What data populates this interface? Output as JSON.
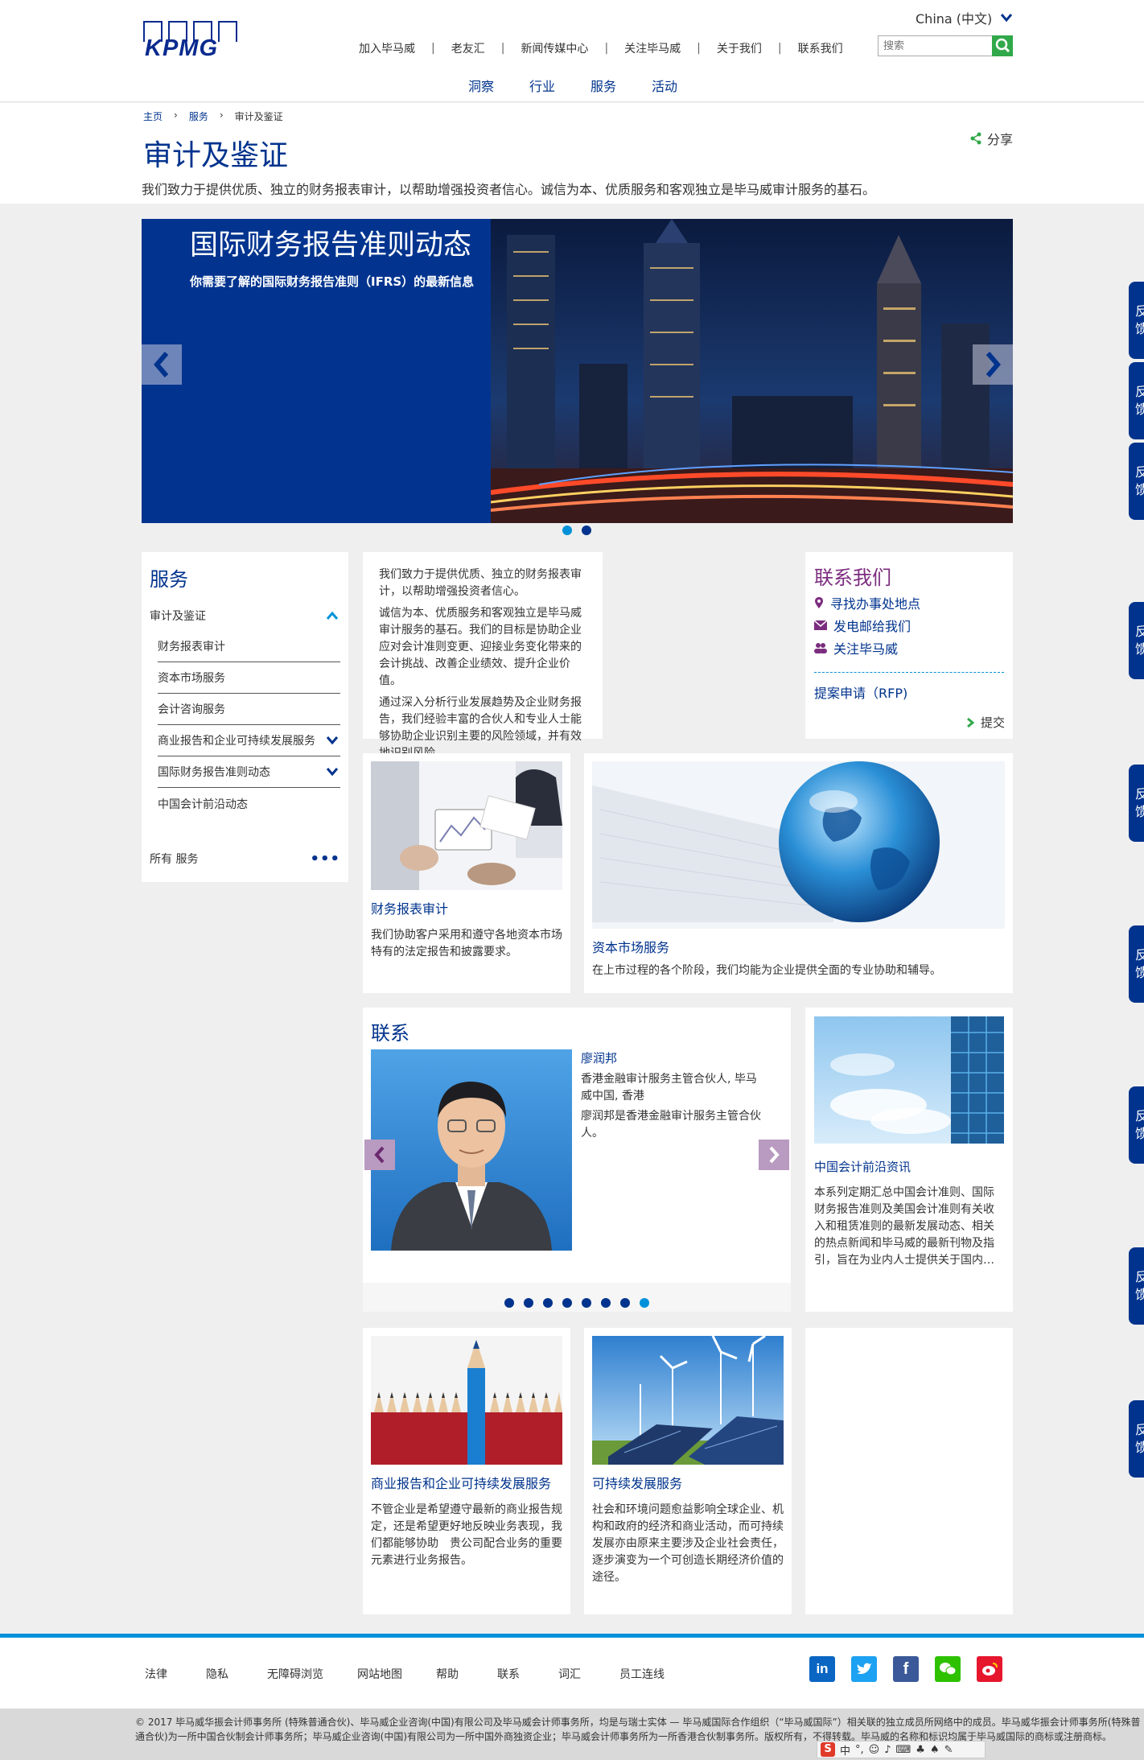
{
  "header": {
    "logo_text": "KPMG",
    "language": "China (中文)",
    "top_links": [
      "加入毕马威",
      "老友汇",
      "新闻传媒中心",
      "关注毕马威",
      "关于我们",
      "联系我们"
    ],
    "search_placeholder": "搜索",
    "main_nav": [
      "洞察",
      "行业",
      "服务",
      "活动"
    ]
  },
  "breadcrumb": [
    "主页",
    "服务",
    "审计及鉴证"
  ],
  "page_title": "审计及鉴证",
  "share_label": "分享",
  "intro": "我们致力于提供优质、独立的财务报表审计，以帮助增强投资者信心。诚信为本、优质服务和客观独立是毕马威审计服务的基石。",
  "hero": {
    "title": "国际财务报告准则动态",
    "subtitle": "你需要了解的国际财务报告准则（IFRS）的最新信息"
  },
  "sidebar": {
    "title": "服务",
    "current": "审计及鉴证",
    "items": [
      {
        "label": "财务报表审计",
        "expand": false
      },
      {
        "label": "资本市场服务",
        "expand": false
      },
      {
        "label": "会计咨询服务",
        "expand": false
      },
      {
        "label": "商业报告和企业可持续发展服务",
        "expand": true
      },
      {
        "label": "国际财务报告准则动态",
        "expand": true
      },
      {
        "label": "中国会计前沿动态",
        "expand": false
      }
    ],
    "all_services": "所有 服务"
  },
  "about": {
    "p1": "我们致力于提供优质、独立的财务报表审计，以帮助增强投资者信心。",
    "p2": "诚信为本、优质服务和客观独立是毕马威审计服务的基石。我们的目标是协助企业应对会计准则变更、迎接业务变化带来的会计挑战、改善企业绩效、提升企业价值。",
    "p3": "通过深入分析行业发展趋势及企业财务报告，我们经验丰富的合伙人和专业人士能够协助企业识别主要的风险领域，并有效地识别风险。"
  },
  "contact_us": {
    "title": "联系我们",
    "links": [
      "寻找办事处地点",
      "发电邮给我们",
      "关注毕马威"
    ],
    "rfp": "提案申请（RFP)",
    "submit": "提交"
  },
  "cards": {
    "audit": {
      "title": "财务报表审计",
      "text": "我们协助客户采用和遵守各地资本市场特有的法定报告和披露要求。"
    },
    "capital": {
      "title": "资本市场服务",
      "text": "在上市过程的各个阶段，我们均能为企业提供全面的专业协助和辅导。"
    },
    "china": {
      "title": "中国会计前沿资讯",
      "text": "本系列定期汇总中国会计准则、国际财务报告准则及美国会计准则有关收入和租赁准则的最新发展动态、相关的热点新闻和毕马威的最新刊物及指引，旨在为业内人士提供关于国内…"
    },
    "business": {
      "title": "商业报告和企业可持续发展服务",
      "text": "不管企业是希望遵守最新的商业报告规定，还是希望更好地反映业务表现，我们都能够协助　贵公司配合业务的重要元素进行业务报告。"
    },
    "sustain": {
      "title": "可持续发展服务",
      "text": "社会和环境问题愈益影响全球企业、机构和政府的经济和商业活动，而可持续发展亦由原来主要涉及企业社会责任，逐步演变为一个可创造长期经济价值的途径。"
    }
  },
  "people": {
    "title": "联系",
    "name": "廖润邦",
    "role": "香港金融审计服务主管合伙人, 毕马威中国, 香港",
    "bio": "廖润邦是香港金融审计服务主管合伙人。"
  },
  "feedback_label": "反馈",
  "footer": {
    "links": [
      "法律",
      "隐私",
      "无障碍浏览",
      "网站地图",
      "帮助",
      "联系",
      "词汇",
      "员工连线"
    ],
    "social": [
      "linkedin-icon",
      "twitter-icon",
      "facebook-icon",
      "wechat-icon",
      "weibo-icon"
    ],
    "copyright": "© 2017 毕马威华振会计师事务所 (特殊普通合伙)、毕马威企业咨询(中国)有限公司及毕马威会计师事务所，均是与瑞士实体 — 毕马威国际合作组织（“毕马威国际”）相关联的独立成员所网络中的成员。毕马威华振会计师事务所(特殊普通合伙)为一所中国合伙制会计师事务所；毕马威企业咨询(中国)有限公司为一所中国外商独资企业；毕马威会计师事务所为一所香港合伙制事务所。版权所有，不得转载。毕马威的名称和标识均属于毕马威国际的商标或注册商标。",
    "ime_text": "中"
  },
  "colors": {
    "brand": "#00338d",
    "accent": "#0091da",
    "green": "#31a84a",
    "purple": "#7c2d7f"
  }
}
